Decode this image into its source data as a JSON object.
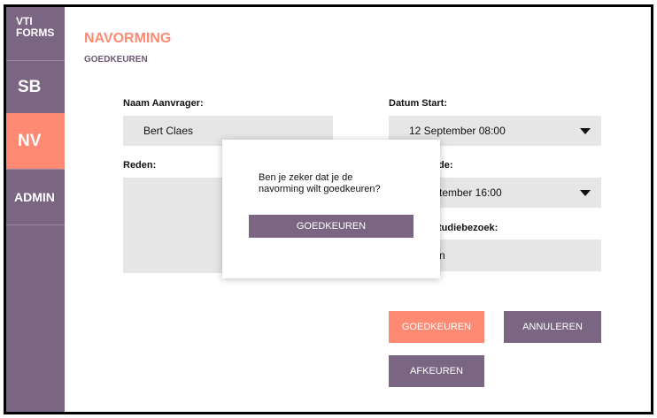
{
  "sidebar": {
    "logo_line1": "VTI",
    "logo_line2": "FORMS",
    "items": [
      {
        "label": "SB"
      },
      {
        "label": "NV"
      },
      {
        "label": "ADMIN"
      }
    ]
  },
  "header": {
    "title": "NAVORMING",
    "subtitle": "GOEDKEUREN"
  },
  "form": {
    "applicant_label": "Naam Aanvrager:",
    "applicant_value": "Bert Claes",
    "reason_label": "Reden:",
    "reason_value": "",
    "start_label": "Datum Start:",
    "start_value": "12 September 08:00",
    "end_label_visible": "de:",
    "end_value_visible": "tember 16:00",
    "visit_label_visible": "tudiebezoek:",
    "visit_value_visible": "n"
  },
  "actions": {
    "approve": "GOEDKEUREN",
    "cancel": "ANNULEREN",
    "reject": "AFKEUREN"
  },
  "modal": {
    "message_line1": "Ben je zeker dat je de",
    "message_line2": "navorming wilt goedkeuren?",
    "confirm": "GOEDKEUREN"
  },
  "colors": {
    "accent": "#ff8a73",
    "primary": "#7a6583",
    "field_bg": "#e6e6e6"
  }
}
